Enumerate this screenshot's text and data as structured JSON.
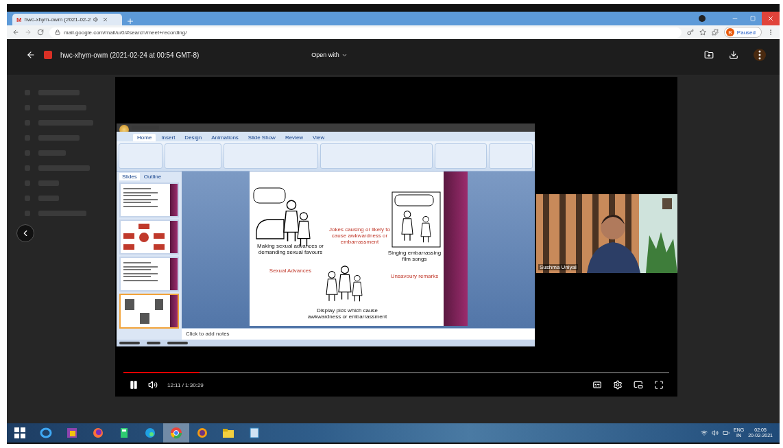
{
  "browser": {
    "tab": {
      "favicon": "M",
      "title": "hwc-xhym-owm (2021-02-2"
    },
    "url": "mail.google.com/mail/u/0/#search/meet+recording/",
    "profile": {
      "letter": "B",
      "label": "Paused"
    }
  },
  "viewer": {
    "title": "hwc-xhym-owm (2021-02-24 at 00:54 GMT-8)",
    "open_with": "Open with"
  },
  "presentation": {
    "ribbon_tabs": [
      {
        "label": "Home",
        "selected": true
      },
      {
        "label": "Insert",
        "selected": false
      },
      {
        "label": "Design",
        "selected": false
      },
      {
        "label": "Animations",
        "selected": false
      },
      {
        "label": "Slide Show",
        "selected": false
      },
      {
        "label": "Review",
        "selected": false
      },
      {
        "label": "View",
        "selected": false
      }
    ],
    "panel_tabs": [
      {
        "label": "Slides",
        "selected": true
      },
      {
        "label": "Outline",
        "selected": false
      }
    ],
    "thumbnails": [
      {
        "kind": "text",
        "selected": false
      },
      {
        "kind": "diagram",
        "selected": false
      },
      {
        "kind": "text",
        "selected": false
      },
      {
        "kind": "cartoons",
        "selected": true
      }
    ],
    "slide": {
      "captions": [
        {
          "kind": "caption",
          "text": "Making sexual advances or demanding sexual favours"
        },
        {
          "kind": "heading",
          "text": "Jokes causing or likely to cause awkwardness or embarrassment"
        },
        {
          "kind": "caption",
          "text": "Singing embarrassing film songs"
        },
        {
          "kind": "heading",
          "text": "Sexual Advances"
        },
        {
          "kind": "heading",
          "text": "Unsavoury remarks"
        },
        {
          "kind": "caption",
          "text": "Display pics which cause awkwardness or embarrassment"
        }
      ]
    },
    "notes_placeholder": "Click to add notes"
  },
  "participant": {
    "name": "Sushma Uniyal"
  },
  "player": {
    "playing": true,
    "level": 0.14,
    "time": "12:11 / 1:30:29"
  },
  "taskbar": {
    "apps": [
      {
        "kind": "start",
        "selected": false
      },
      {
        "kind": "ie",
        "selected": false
      },
      {
        "kind": "photos",
        "selected": false
      },
      {
        "kind": "firefox",
        "selected": false
      },
      {
        "kind": "calculator",
        "selected": false
      },
      {
        "kind": "edge",
        "selected": false
      },
      {
        "kind": "chrome",
        "selected": true
      },
      {
        "kind": "app",
        "selected": false
      },
      {
        "kind": "files",
        "selected": false
      },
      {
        "kind": "notes",
        "selected": false
      }
    ],
    "language": [
      "ENG",
      "IN"
    ],
    "time": "02:05",
    "date": "20-02-2021"
  }
}
